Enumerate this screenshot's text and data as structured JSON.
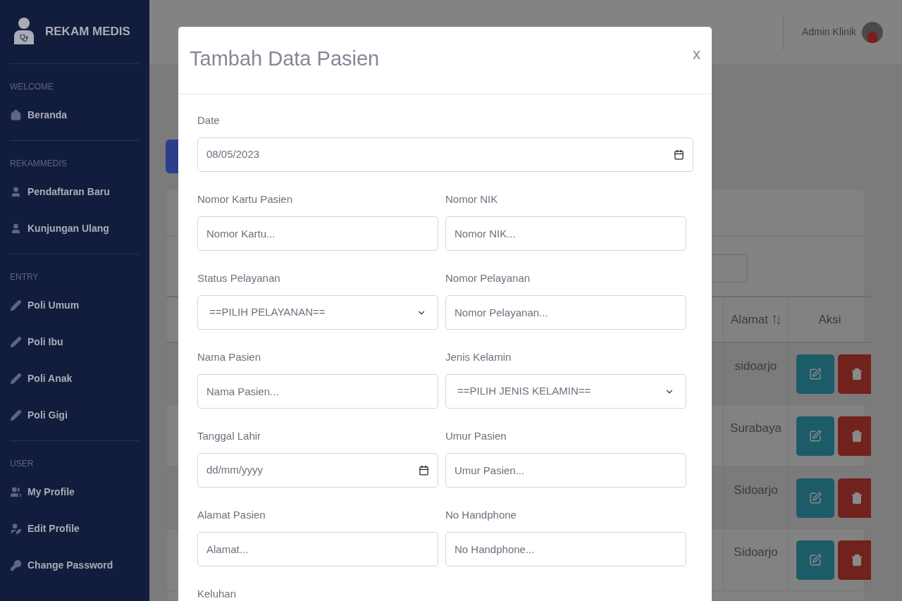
{
  "sidebar": {
    "brand": "REKAM MEDIS",
    "sections": [
      {
        "heading": "WELCOME",
        "items": [
          {
            "label": "Beranda",
            "kind": "home"
          }
        ]
      },
      {
        "heading": "REKAMMEDIS",
        "items": [
          {
            "label": "Pendaftaran Baru",
            "kind": "user"
          },
          {
            "label": "Kunjungan Ulang",
            "kind": "user"
          }
        ]
      },
      {
        "heading": "ENTRY",
        "items": [
          {
            "label": "Poli Umum",
            "kind": "pencil"
          },
          {
            "label": "Poli Ibu",
            "kind": "pencil"
          },
          {
            "label": "Poli Anak",
            "kind": "pencil"
          },
          {
            "label": "Poli Gigi",
            "kind": "pencil"
          }
        ]
      },
      {
        "heading": "USER",
        "items": [
          {
            "label": "My Profile",
            "kind": "users"
          },
          {
            "label": "Edit Profile",
            "kind": "user-edit"
          },
          {
            "label": "Change Password",
            "kind": "key"
          }
        ]
      }
    ]
  },
  "header": {
    "user": "Admin Klinik"
  },
  "table": {
    "columns": [
      "Alamat",
      "Aksi"
    ],
    "rows": [
      {
        "alamat": "sidoarjo"
      },
      {
        "alamat": "Surabaya"
      },
      {
        "alamat": "Sidoarjo"
      },
      {
        "alamat": "Sidoarjo"
      }
    ]
  },
  "modal": {
    "title": "Tambah Data Pasien",
    "close": "x",
    "fields": [
      {
        "kind": "date",
        "label": "Date",
        "value": "08/05/2023"
      },
      {
        "kind": "text",
        "label": "Nomor Kartu Pasien",
        "placeholder": "Nomor Kartu..."
      },
      {
        "kind": "text",
        "label": "Nomor NIK",
        "placeholder": "Nomor NIK..."
      },
      {
        "kind": "select",
        "label": "Status Pelayanan",
        "value": "==PILIH PELAYANAN=="
      },
      {
        "kind": "text",
        "label": "Nomor Pelayanan",
        "placeholder": "Nomor Pelayanan..."
      },
      {
        "kind": "text",
        "label": "Nama Pasien",
        "placeholder": "Nama Pasien..."
      },
      {
        "kind": "select",
        "label": "Jenis Kelamin",
        "value": "==PILIH JENIS KELAMIN=="
      },
      {
        "kind": "date",
        "label": "Tanggal Lahir",
        "placeholder": "dd/mm/yyyy"
      },
      {
        "kind": "text",
        "label": "Umur Pasien",
        "placeholder": "Umur Pasien..."
      },
      {
        "kind": "text",
        "label": "Alamat Pasien",
        "placeholder": "Alamat..."
      },
      {
        "kind": "text",
        "label": "No Handphone",
        "placeholder": "No Handphone..."
      },
      {
        "kind": "label",
        "label": "Keluhan"
      }
    ]
  }
}
